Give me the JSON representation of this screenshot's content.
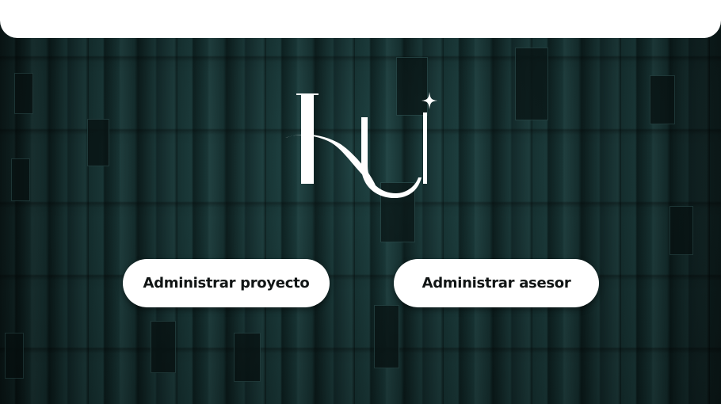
{
  "header": {},
  "logo": {
    "icon": "hu-monogram-logo"
  },
  "actions": {
    "manage_project_label": "Administrar proyecto",
    "manage_advisor_label": "Administrar asesor"
  },
  "colors": {
    "background": "#132b2b",
    "button_bg": "#ffffff",
    "button_text": "#111515",
    "header_bg": "#ffffff"
  }
}
